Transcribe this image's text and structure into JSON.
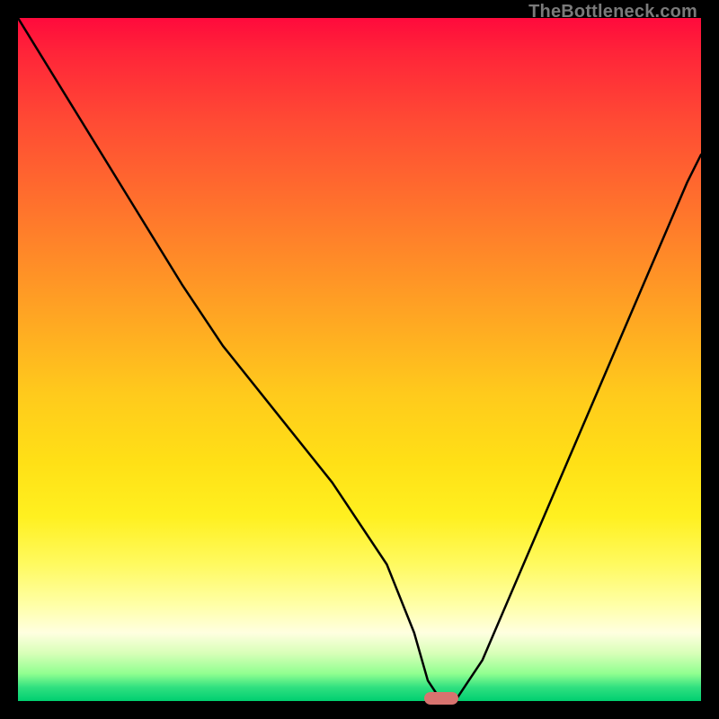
{
  "watermark": "TheBottleneck.com",
  "colors": {
    "background": "#000000",
    "curve": "#000000",
    "marker": "#d8736f"
  },
  "chart_data": {
    "type": "line",
    "title": "",
    "xlabel": "",
    "ylabel": "",
    "xlim": [
      0,
      100
    ],
    "ylim": [
      0,
      100
    ],
    "series": [
      {
        "name": "bottleneck-curve",
        "x": [
          0,
          8,
          16,
          24,
          30,
          38,
          46,
          54,
          58,
          60,
          62,
          64,
          68,
          74,
          80,
          86,
          92,
          98,
          100
        ],
        "y": [
          100,
          87,
          74,
          61,
          52,
          42,
          32,
          20,
          10,
          3,
          0,
          0,
          6,
          20,
          34,
          48,
          62,
          76,
          80
        ]
      }
    ],
    "marker": {
      "x": 62,
      "y": 0
    },
    "gradient_stops": [
      {
        "pos": 0.0,
        "color": "#ff0a3c"
      },
      {
        "pos": 0.25,
        "color": "#ff6a2e"
      },
      {
        "pos": 0.5,
        "color": "#ffca1c"
      },
      {
        "pos": 0.8,
        "color": "#fffa60"
      },
      {
        "pos": 1.0,
        "color": "#00cf70"
      }
    ]
  }
}
